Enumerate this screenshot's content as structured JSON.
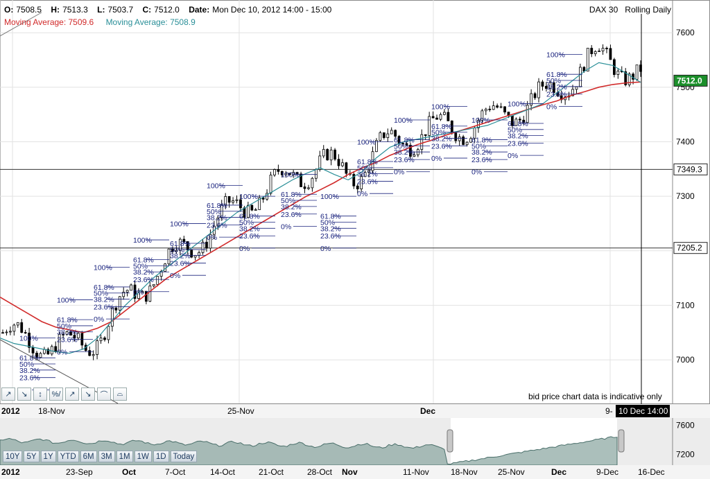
{
  "header": {
    "open_label": "O:",
    "open": "7508.5",
    "high_label": "H:",
    "high": "7513.3",
    "low_label": "L:",
    "low": "7503.7",
    "close_label": "C:",
    "close": "7512.0",
    "date_label": "Date:",
    "date": "Mon Dec 10, 2012 14:00 - 15:00",
    "ma_red": "Moving Average: 7509.6",
    "ma_teal": "Moving Average: 7508.9",
    "symbol": "DAX 30",
    "mode": "Rolling Daily"
  },
  "disclaimer": "bid price chart data is indicative only",
  "toolbar": {
    "icons": [
      "trend-line-up-icon",
      "trend-line-down-icon",
      "candlestick-icon",
      "percent-icon",
      "arrow-line-icon",
      "arrow-down-icon",
      "arc-icon",
      "curve-icon"
    ],
    "glyphs": [
      "↗",
      "↘",
      "↕",
      "%/",
      "↗",
      "↘",
      "⌒",
      "⌓"
    ]
  },
  "range_buttons": [
    "10Y",
    "5Y",
    "1Y",
    "YTD",
    "6M",
    "3M",
    "1M",
    "1W",
    "1D",
    "Today"
  ],
  "colors": {
    "ma_red": "#d12a2a",
    "ma_teal": "#2a8f98",
    "candle": "#000000",
    "fib": "#1a237e",
    "nav_fill": "#7f9a96"
  },
  "chart_data": [
    {
      "type": "candlestick",
      "title": "DAX 30",
      "ylim": [
        6920,
        7660
      ],
      "y_ticks": [
        7000,
        7100,
        7200,
        7300,
        7400,
        7500,
        7600
      ],
      "price_markers": [
        7512.0,
        7349.3,
        7205.2
      ],
      "price_marker_labels": [
        "7512.0",
        "7349.3",
        "7205.2"
      ],
      "year_label": "2012",
      "x_labels": [
        "18-Nov",
        "25-Nov",
        "Dec",
        "9-"
      ],
      "crosshair_label": "10 Dec 14:00",
      "grid": true,
      "series": [
        {
          "name": "Moving Average",
          "color": "#d12a2a",
          "values": [
            7115,
            7100,
            7085,
            7070,
            7060,
            7055,
            7050,
            7058,
            7070,
            7090,
            7110,
            7130,
            7150,
            7165,
            7180,
            7195,
            7210,
            7225,
            7240,
            7255,
            7270,
            7285,
            7300,
            7312,
            7325,
            7340,
            7352,
            7362,
            7375,
            7385,
            7395,
            7403,
            7412,
            7420,
            7428,
            7436,
            7444,
            7452,
            7460,
            7468,
            7475,
            7485,
            7492,
            7500,
            7505,
            7508,
            7509.6
          ]
        },
        {
          "name": "Moving Average",
          "color": "#2a8f98",
          "values": [
            7040,
            7030,
            7025,
            7020,
            7015,
            7012,
            7020,
            7040,
            7070,
            7100,
            7125,
            7150,
            7170,
            7190,
            7210,
            7230,
            7250,
            7270,
            7285,
            7300,
            7315,
            7330,
            7342,
            7352,
            7340,
            7330,
            7345,
            7370,
            7390,
            7400,
            7405,
            7410,
            7415,
            7420,
            7425,
            7430,
            7440,
            7450,
            7460,
            7470,
            7490,
            7510,
            7530,
            7545,
            7540,
            7525,
            7508.9
          ]
        }
      ],
      "fib_levels": [
        "0%",
        "23.6%",
        "38.2%",
        "50%",
        "61.8%",
        "100%"
      ]
    },
    {
      "type": "area",
      "title": "",
      "x_labels": [
        "23-Sep",
        "Oct",
        "7-Oct",
        "14-Oct",
        "21-Oct",
        "28-Oct",
        "Nov",
        "11-Nov",
        "18-Nov",
        "25-Nov",
        "Dec",
        "9-Dec",
        "16-Dec"
      ],
      "year_label": "2012",
      "y_ticks": [
        7200,
        7600
      ],
      "ylim": [
        7050,
        7700
      ]
    }
  ]
}
